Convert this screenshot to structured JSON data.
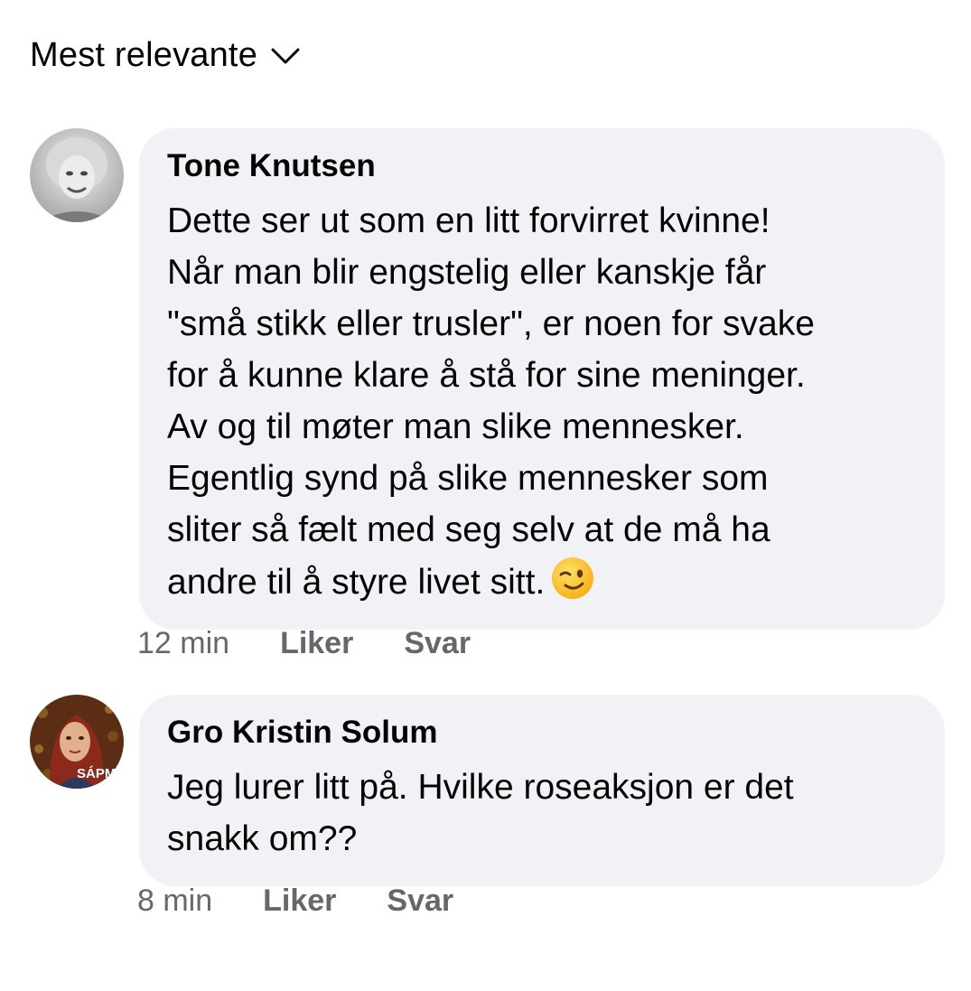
{
  "sort": {
    "label": "Mest relevante",
    "icon": "chevron-down-icon"
  },
  "comments": [
    {
      "author": "Tone Knutsen",
      "lines": [
        "Dette ser ut som en litt forvirret kvinne!",
        "Når man blir engstelig eller kanskje får",
        "\"små stikk eller trusler\", er noen for svake",
        "for å kunne klare å stå for sine meninger.",
        "Av og til møter man slike mennesker.",
        "Egentlig synd på slike mennesker som",
        "sliter så fælt med seg selv at de må ha",
        "andre til å styre livet sitt."
      ],
      "emoji": "winking-face-emoji",
      "time": "12 min",
      "like_label": "Liker",
      "reply_label": "Svar"
    },
    {
      "author": "Gro Kristin Solum",
      "lines": [
        "Jeg lurer litt på. Hvilke roseaksjon er det",
        "snakk om??"
      ],
      "avatar_text": "SÁPM",
      "time": "8 min",
      "like_label": "Liker",
      "reply_label": "Svar"
    }
  ],
  "colors": {
    "bubble": "#f0f2f5",
    "meta_text": "#65676b",
    "text": "#050505"
  }
}
